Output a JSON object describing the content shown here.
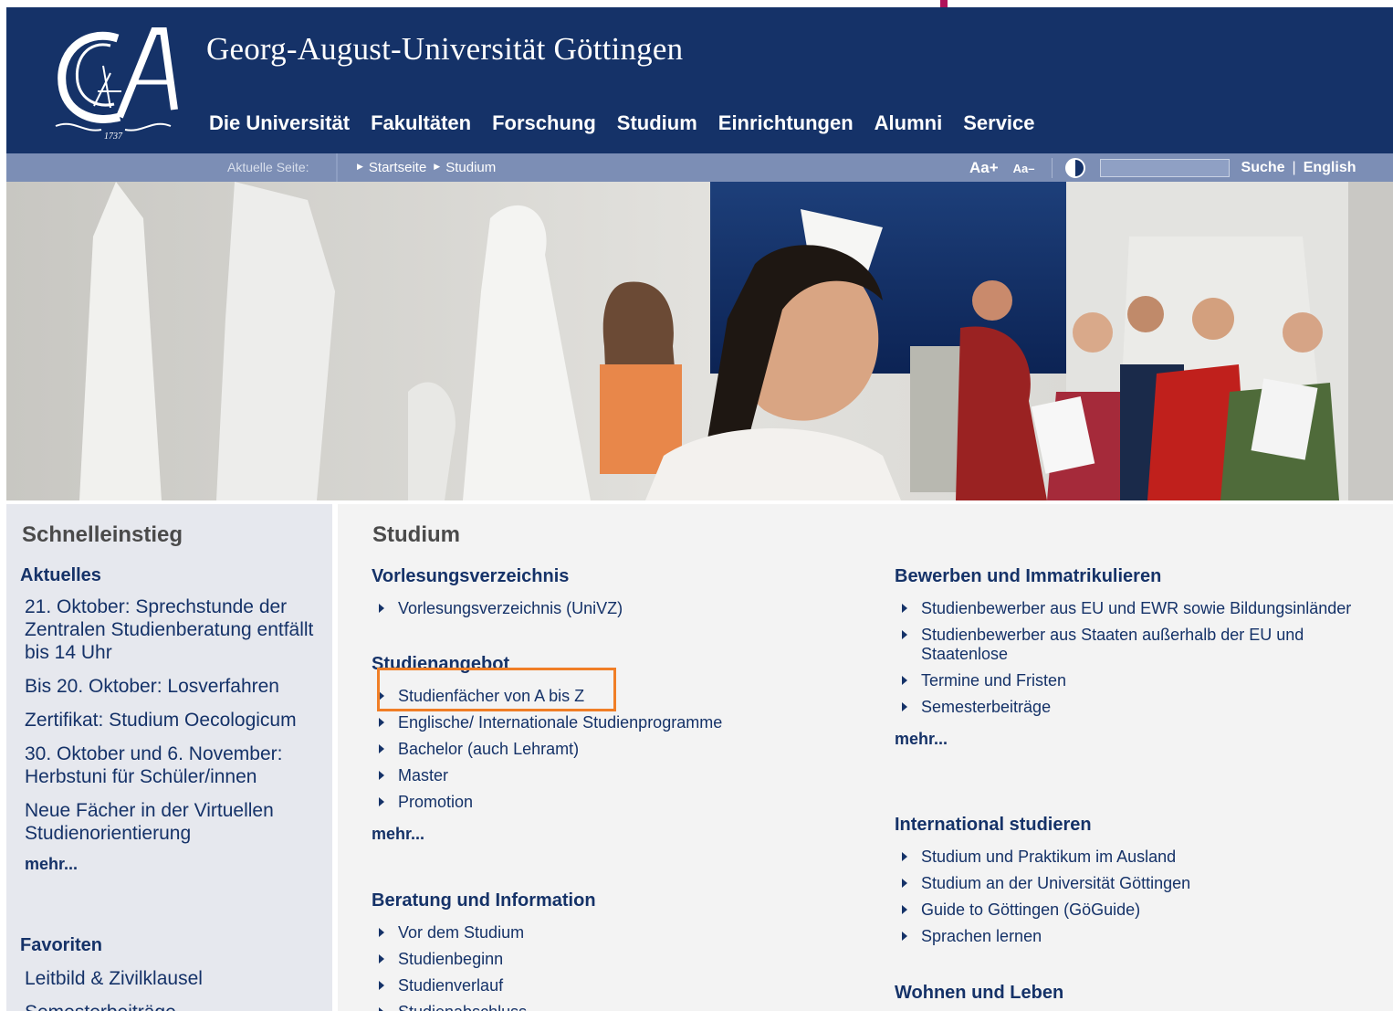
{
  "header": {
    "site_title": "Georg-August-Universität Göttingen",
    "logo_year": "1737",
    "nav": [
      "Die Universität",
      "Fakultäten",
      "Forschung",
      "Studium",
      "Einrichtungen",
      "Alumni",
      "Service"
    ]
  },
  "crumbbar": {
    "label": "Aktuelle Seite:",
    "crumbs": [
      "Startseite",
      "Studium"
    ],
    "font_larger": "Aa+",
    "font_smaller": "Aa–",
    "search_placeholder": "",
    "search_button": "Suche",
    "separator": "|",
    "language": "English"
  },
  "sidebar": {
    "title": "Schnelleinstieg",
    "aktuelles_heading": "Aktuelles",
    "aktuelles": [
      "21. Oktober: Sprechstunde der Zentralen Studienberatung entfällt bis 14 Uhr",
      "Bis 20. Oktober: Losverfahren",
      "Zertifikat: Studium Oecologicum",
      "30. Oktober und 6. November: Herbstuni für Schüler/innen",
      "Neue Fächer in der Virtuellen Studienorientierung"
    ],
    "more": "mehr...",
    "favoriten_heading": "Favoriten",
    "favoriten": [
      "Leitbild & Zivilklausel",
      "Semesterbeiträge"
    ]
  },
  "main": {
    "title": "Studium",
    "vorlesung": {
      "heading": "Vorlesungsverzeichnis",
      "items": [
        "Vorlesungsverzeichnis (UniVZ)"
      ]
    },
    "studienangebot": {
      "heading": "Studienangebot",
      "items": [
        "Studienfächer von A bis Z",
        "Englische/ Internationale Studienprogramme",
        "Bachelor (auch Lehramt)",
        "Master",
        "Promotion"
      ],
      "more": "mehr..."
    },
    "beratung": {
      "heading": "Beratung und Information",
      "items": [
        "Vor dem Studium",
        "Studienbeginn",
        "Studienverlauf",
        "Studienabschluss"
      ]
    },
    "bewerben": {
      "heading": "Bewerben und Immatrikulieren",
      "items": [
        "Studienbewerber aus EU und EWR sowie Bildungsinländer",
        "Studienbewerber aus Staaten außerhalb der EU und Staatenlose",
        "Termine und Fristen",
        "Semesterbeiträge"
      ],
      "more": "mehr..."
    },
    "international": {
      "heading": "International studieren",
      "items": [
        "Studium und Praktikum im Ausland",
        "Studium an der Universität Göttingen",
        "Guide to Göttingen (GöGuide)",
        "Sprachen lernen"
      ]
    },
    "wohnen": {
      "heading": "Wohnen und Leben"
    }
  },
  "colors": {
    "brand_blue": "#153268",
    "crumb_bar": "#7c8eb5",
    "sidebar_bg": "#e6e8ee",
    "highlight": "#f07e26"
  }
}
